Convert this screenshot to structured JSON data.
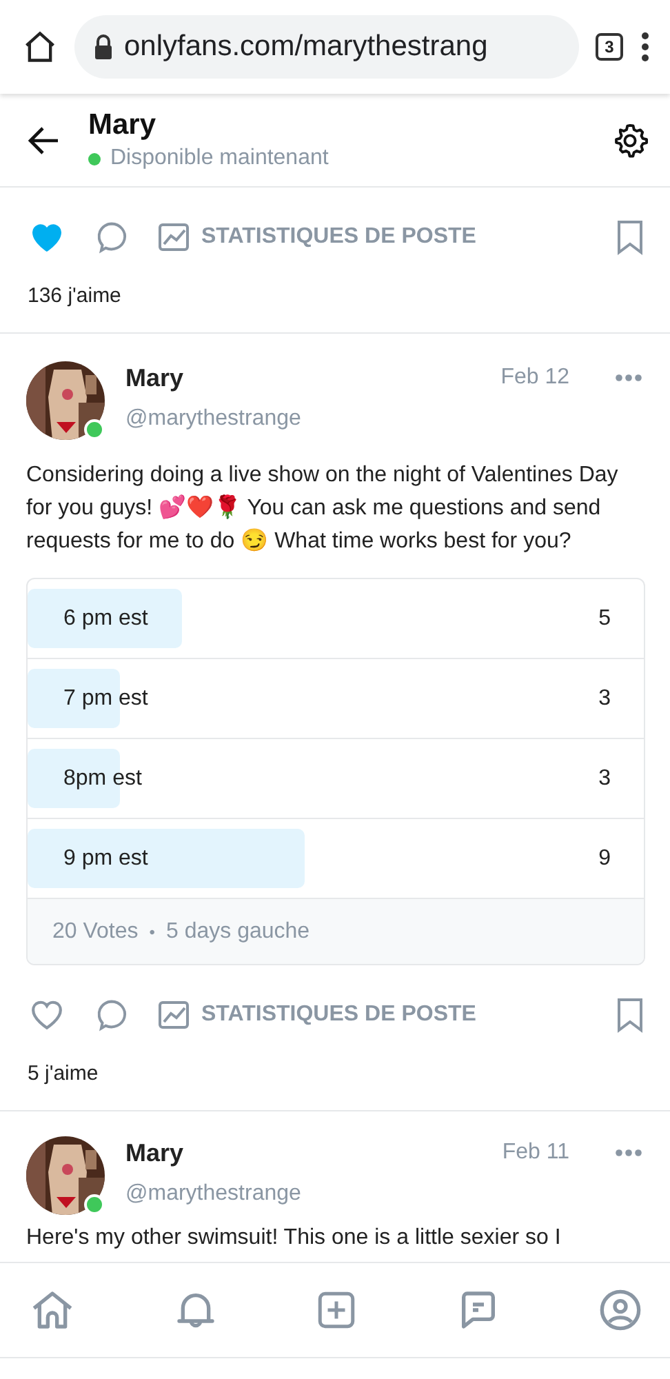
{
  "browser": {
    "url": "onlyfans.com/marythestrang",
    "tab_count": "3"
  },
  "header": {
    "name": "Mary",
    "status": "Disponible maintenant",
    "online": true
  },
  "feed": [
    {
      "kind": "actions",
      "liked": true,
      "stats_label": "STATISTIQUES DE POSTE",
      "likes": "136 j'aime"
    },
    {
      "kind": "post",
      "name": "Mary",
      "handle": "@marythestrange",
      "date": "Feb 12",
      "online": true,
      "text": "Considering doing a live show on the night of Valentines Day for you guys! 💕❤️🌹 You can ask me questions and send requests for me to do 😏 What time works best for you?",
      "poll": {
        "options": [
          {
            "label": "6 pm est",
            "count": "5",
            "level": 0.25
          },
          {
            "label": "7 pm est",
            "count": "3",
            "level": 0.15
          },
          {
            "label": "8pm est",
            "count": "3",
            "level": 0.15
          },
          {
            "label": "9 pm est",
            "count": "9",
            "level": 0.45
          }
        ],
        "votes": "20 Votes",
        "separator": "•",
        "time_left": "5 days gauche"
      }
    },
    {
      "kind": "actions",
      "liked": false,
      "stats_label": "STATISTIQUES DE POSTE",
      "likes": "5 j'aime"
    },
    {
      "kind": "post",
      "name": "Mary",
      "handle": "@marythestrange",
      "date": "Feb 11",
      "online": true,
      "text": "Here's my other swimsuit! This one is a little sexier so I"
    }
  ]
}
